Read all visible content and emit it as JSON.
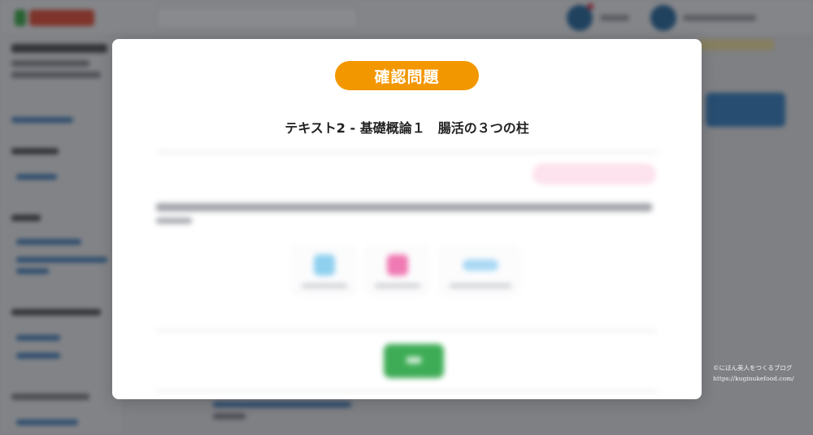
{
  "modal": {
    "badge_label": "確認問題",
    "title": "テキスト2 - 基礎概論１　腸活の３つの柱"
  },
  "watermark": {
    "line1": "©にほん美人をつくるブログ",
    "line2": "https://kuginukefood.com/"
  },
  "colors": {
    "badge": "#f39700",
    "overlay": "rgba(20,22,28,0.5)",
    "confirm_button": "#3eac56",
    "top_button": "#3b86c6"
  },
  "icons": {
    "close": "close-icon",
    "quiz_option_1": "circle-option-icon",
    "quiz_option_2": "cross-option-icon",
    "quiz_option_3": "pill-option-icon"
  }
}
